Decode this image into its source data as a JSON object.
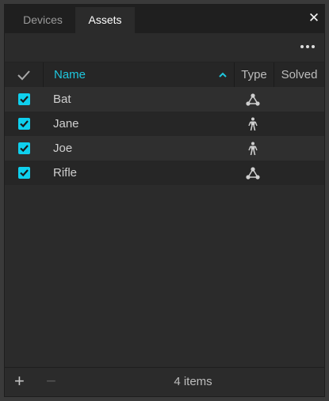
{
  "tabs": [
    {
      "label": "Devices",
      "active": false
    },
    {
      "label": "Assets",
      "active": true
    }
  ],
  "close_icon": "close-icon",
  "more_icon": "more-icon",
  "columns": {
    "check": "✓",
    "name": "Name",
    "type": "Type",
    "solved": "Solved",
    "sort_indicator": "^"
  },
  "rows": [
    {
      "name": "Bat",
      "checked": true,
      "type_icon": "rigid-body-icon"
    },
    {
      "name": "Jane",
      "checked": true,
      "type_icon": "skeleton-icon"
    },
    {
      "name": "Joe",
      "checked": true,
      "type_icon": "skeleton-icon"
    },
    {
      "name": "Rifle",
      "checked": true,
      "type_icon": "rigid-body-icon"
    }
  ],
  "footer": {
    "add_label": "+",
    "remove_label": "−",
    "count": "4 items"
  },
  "colors": {
    "accent": "#1fc7de",
    "checkbox": "#0fd0ee"
  }
}
